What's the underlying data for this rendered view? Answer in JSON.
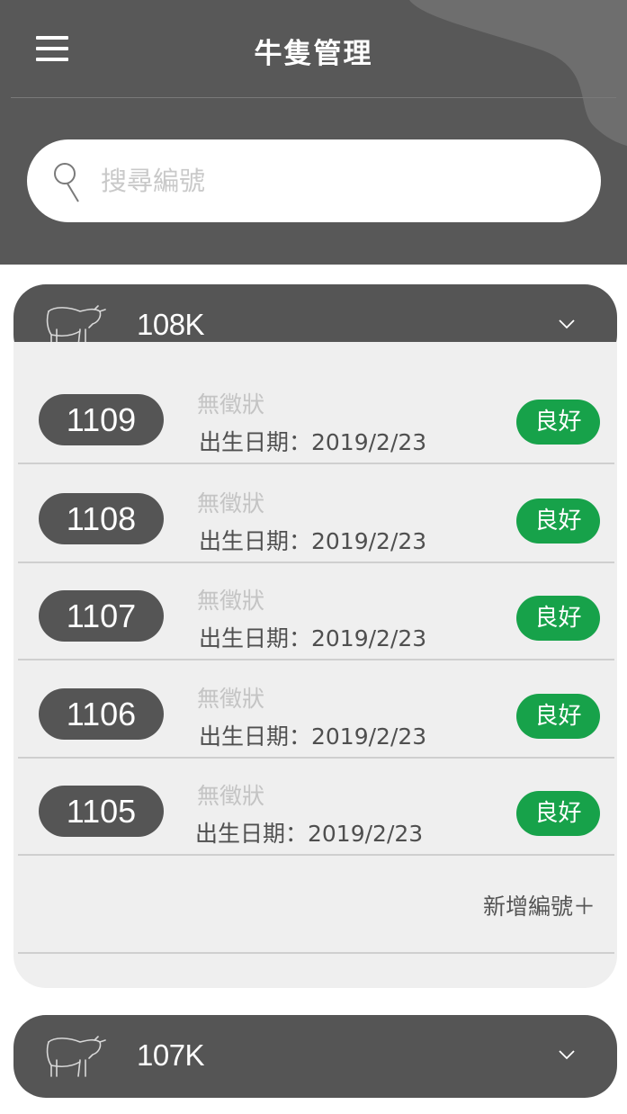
{
  "header": {
    "title": "牛隻管理",
    "colors": {
      "background": "#585858",
      "accent": "#17a24a"
    }
  },
  "search": {
    "placeholder": "搜尋編號"
  },
  "groups": [
    {
      "name": "108K",
      "expanded": true,
      "items": [
        {
          "id": "1109",
          "symptom": "無徵狀",
          "birth": "出生日期：2019/2/23",
          "status": "良好"
        },
        {
          "id": "1108",
          "symptom": "無徵狀",
          "birth": "出生日期：2019/2/23",
          "status": "良好"
        },
        {
          "id": "1107",
          "symptom": "無徵狀",
          "birth": "出生日期：2019/2/23",
          "status": "良好"
        },
        {
          "id": "1106",
          "symptom": "無徵狀",
          "birth": "出生日期：2019/2/23",
          "status": "良好"
        },
        {
          "id": "1105",
          "symptom": "無徵狀",
          "birth": "出生日期：2019/2/23",
          "status": "良好"
        }
      ],
      "add_label": "新增編號＋"
    },
    {
      "name": "107K",
      "expanded": false
    }
  ],
  "icons": {
    "menu": "hamburger-menu-icon",
    "search": "search-icon",
    "cow": "cow-icon",
    "chevron": "chevron-down-icon"
  }
}
